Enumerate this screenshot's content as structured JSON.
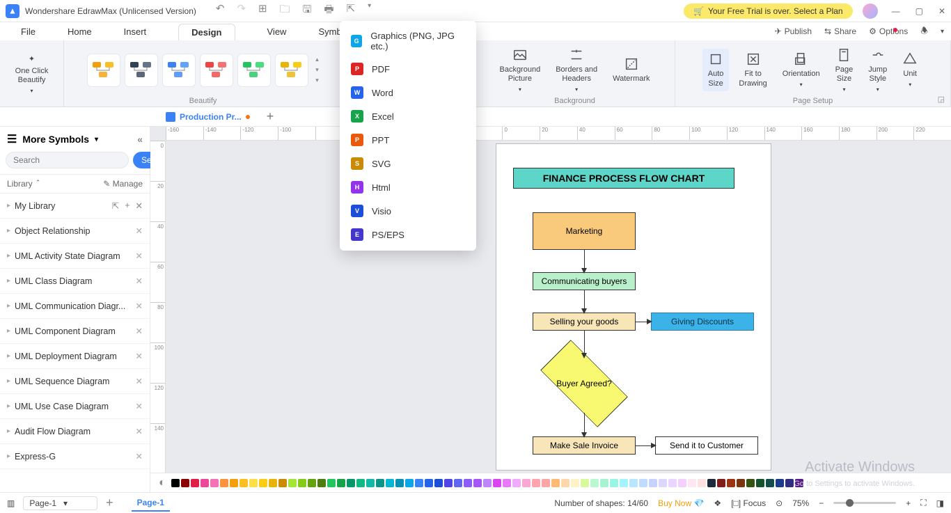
{
  "titlebar": {
    "app_title": "Wondershare EdrawMax (Unlicensed Version)",
    "trial_text": "Your Free Trial is over. Select a Plan"
  },
  "menus": {
    "file": "File",
    "home": "Home",
    "insert": "Insert",
    "design": "Design",
    "view": "View",
    "symbols": "Symbols",
    "publish": "Publish",
    "share": "Share",
    "options": "Options"
  },
  "ribbon": {
    "one_click": "One Click\nBeautify",
    "beautify_group": "Beautify",
    "bg_picture": "Background\nPicture",
    "borders": "Borders and\nHeaders",
    "watermark": "Watermark",
    "background_group": "Background",
    "auto_size": "Auto\nSize",
    "fit": "Fit to\nDrawing",
    "orientation": "Orientation",
    "page_size": "Page\nSize",
    "jump_style": "Jump\nStyle",
    "unit": "Unit",
    "page_setup_group": "Page Setup"
  },
  "doc_tab": "Production Pr...",
  "sidebar": {
    "more_symbols": "More Symbols",
    "search_ph": "Search",
    "search_btn": "Search",
    "library": "Library",
    "manage": "Manage",
    "items": [
      "My Library",
      "Object Relationship",
      "UML Activity State Diagram",
      "UML Class Diagram",
      "UML Communication Diagr...",
      "UML Component Diagram",
      "UML Deployment Diagram",
      "UML Sequence Diagram",
      "UML Use Case Diagram",
      "Audit Flow Diagram",
      "Express-G"
    ]
  },
  "ruler_h": [
    "-160",
    "-140",
    "-120",
    "-100",
    "",
    "",
    "",
    "",
    "",
    "0",
    "20",
    "40",
    "60",
    "80",
    "100",
    "120",
    "140",
    "160",
    "180",
    "200",
    "220"
  ],
  "ruler_v": [
    "0",
    "20",
    "40",
    "60",
    "80",
    "100",
    "120",
    "140"
  ],
  "flowchart": {
    "title": "FINANCE PROCESS FLOW CHART",
    "marketing": "Marketing",
    "commbuy": "Communicating buyers",
    "selling": "Selling your goods",
    "discount": "Giving Discounts",
    "buyer": "Buyer Agreed?",
    "invoice": "Make Sale Invoice",
    "send": "Send it to Customer"
  },
  "export_menu": [
    {
      "label": "Graphics (PNG, JPG etc.)",
      "color": "#0ea5e9",
      "ch": "G"
    },
    {
      "label": "PDF",
      "color": "#dc2626",
      "ch": "P"
    },
    {
      "label": "Word",
      "color": "#2563eb",
      "ch": "W"
    },
    {
      "label": "Excel",
      "color": "#16a34a",
      "ch": "X"
    },
    {
      "label": "PPT",
      "color": "#ea580c",
      "ch": "P"
    },
    {
      "label": "SVG",
      "color": "#ca8a04",
      "ch": "S"
    },
    {
      "label": "Html",
      "color": "#9333ea",
      "ch": "H"
    },
    {
      "label": "Visio",
      "color": "#1d4ed8",
      "ch": "V"
    },
    {
      "label": "PS/EPS",
      "color": "#4338ca",
      "ch": "E"
    }
  ],
  "palette_colors": [
    "#000",
    "#8b0000",
    "#e11d48",
    "#ec4899",
    "#f472b6",
    "#fb923c",
    "#f59e0b",
    "#fbbf24",
    "#fde047",
    "#facc15",
    "#eab308",
    "#ca8a04",
    "#a3e635",
    "#84cc16",
    "#65a30d",
    "#4d7c0f",
    "#22c55e",
    "#16a34a",
    "#059669",
    "#10b981",
    "#14b8a6",
    "#0d9488",
    "#06b6d4",
    "#0891b2",
    "#0ea5e9",
    "#3b82f6",
    "#2563eb",
    "#1d4ed8",
    "#4f46e5",
    "#6366f1",
    "#8b5cf6",
    "#a855f7",
    "#c084fc",
    "#d946ef",
    "#e879f9",
    "#f0abfc",
    "#f9a8d4",
    "#fda4af",
    "#fca5a5",
    "#fdba74",
    "#fed7aa",
    "#fef3c7",
    "#d9f99d",
    "#bbf7d0",
    "#a7f3d0",
    "#99f6e4",
    "#a5f3fc",
    "#bae6fd",
    "#bfdbfe",
    "#c7d2fe",
    "#ddd6fe",
    "#e9d5ff",
    "#f5d0fe",
    "#fce7f3",
    "#fee2e2"
  ],
  "status": {
    "page_dropdown": "Page-1",
    "page_tab": "Page-1",
    "shape_count": "Number of shapes: 14/60",
    "buy_now": "Buy Now",
    "focus": "Focus",
    "zoom": "75%"
  },
  "watermark": "Activate Windows",
  "watermark2": "Go to Settings to activate Windows."
}
